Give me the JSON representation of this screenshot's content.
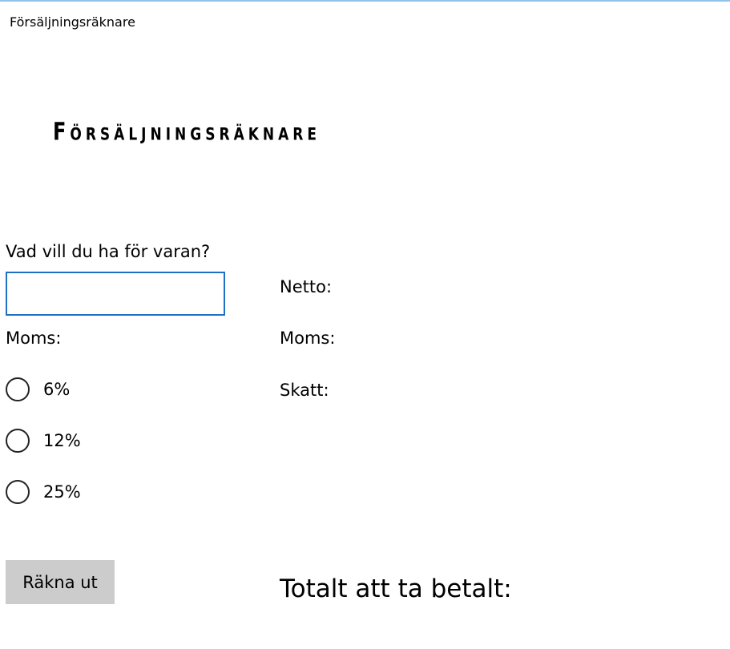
{
  "window": {
    "title": "Försäljningsräknare"
  },
  "header": {
    "title": "Försäljningsräknare"
  },
  "form": {
    "price_question": "Vad vill du ha för varan?",
    "price_value": "",
    "vat_label": "Moms:",
    "vat_options": [
      {
        "label": "6%",
        "selected": false
      },
      {
        "label": "12%",
        "selected": false
      },
      {
        "label": "25%",
        "selected": false
      }
    ],
    "calculate_label": "Räkna ut"
  },
  "results": {
    "net_label": "Netto:",
    "vat_label": "Moms:",
    "tax_label": "Skatt:",
    "total_label": "Totalt att ta betalt:"
  },
  "colors": {
    "input_border": "#1f6fc4",
    "button_bg": "#cccccc",
    "titlebar_accent": "#8fc3ea"
  }
}
